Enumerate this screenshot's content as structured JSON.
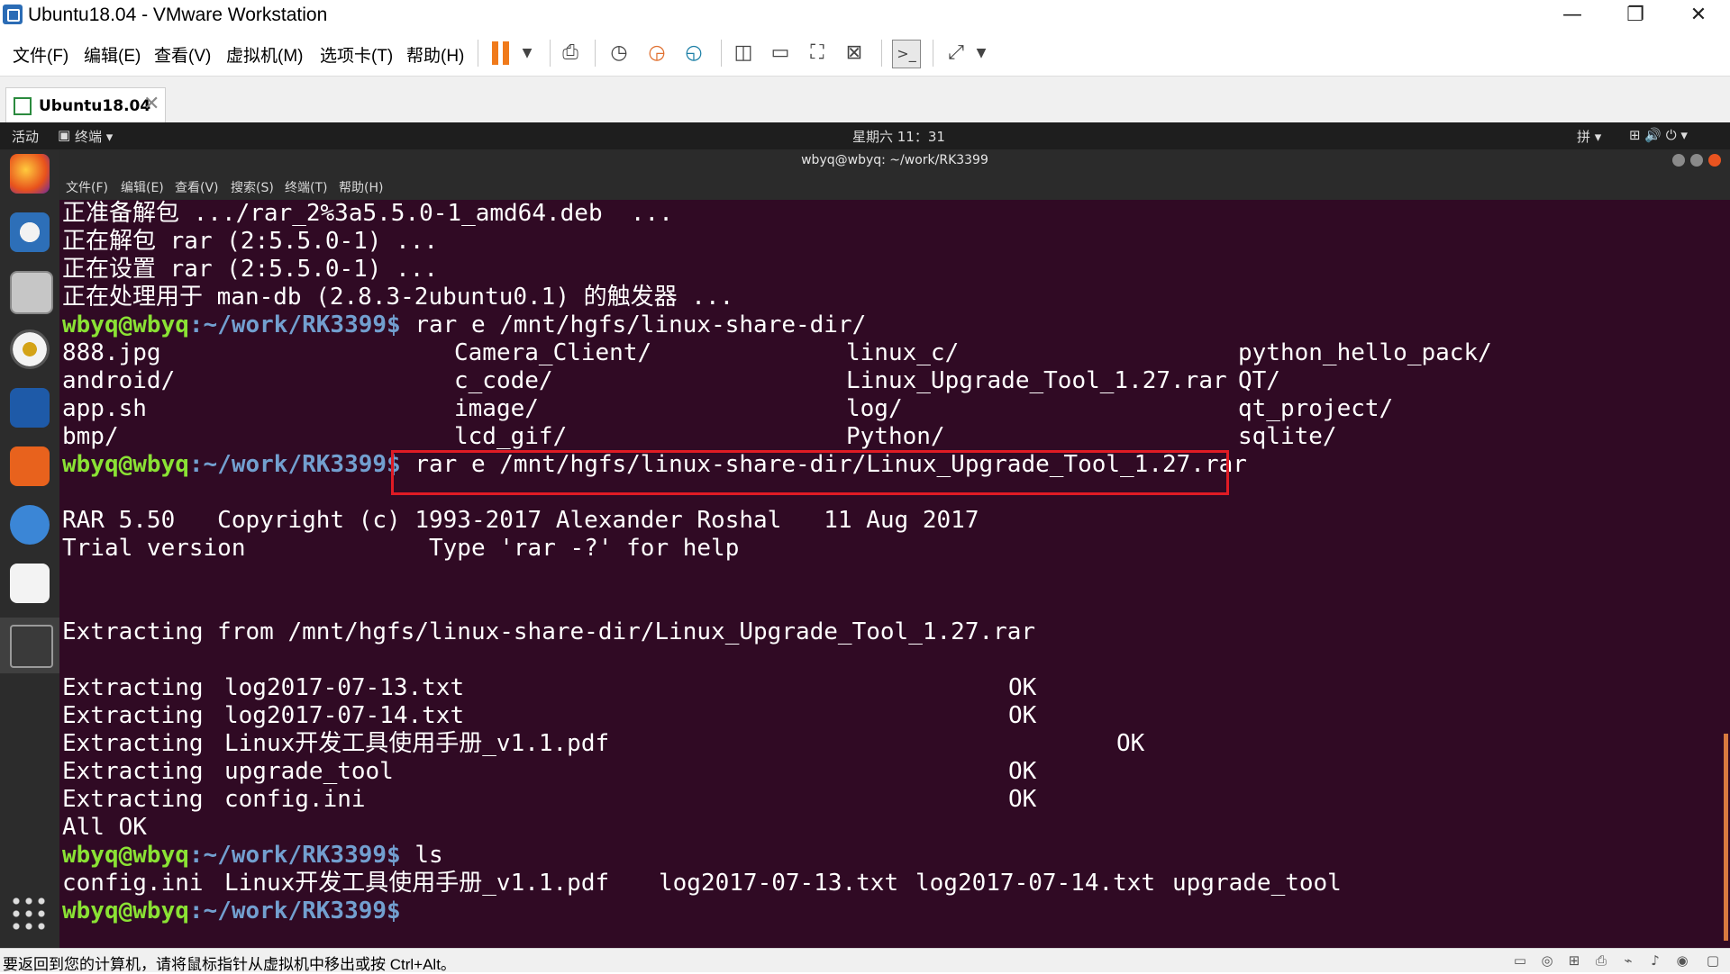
{
  "window": {
    "title": "Ubuntu18.04 - VMware Workstation",
    "minimize": "—",
    "restore": "❐",
    "close": "✕"
  },
  "menu": [
    "文件(F)",
    "编辑(E)",
    "查看(V)",
    "虚拟机(M)",
    "选项卡(T)",
    "帮助(H)"
  ],
  "tab": {
    "label": "Ubuntu18.04",
    "close": "✕"
  },
  "gnome_panel": {
    "activities": "活动",
    "app_menu": "终端 ▾",
    "clock": "星期六 11：31",
    "input_method": "拼 ▾",
    "system_icons": "⊞  🔊  ⏻ ▾"
  },
  "terminal": {
    "title": "wbyq@wbyq: ~/work/RK3399",
    "menu": [
      "文件(F)",
      "编辑(E)",
      "查看(V)",
      "搜索(S)",
      "终端(T)",
      "帮助(H)"
    ],
    "prompt_user": "wbyq@wbyq",
    "prompt_path": ":~/work/RK3399$",
    "lines": {
      "l1": "正准备解包 .../rar_2%3a5.5.0-1_amd64.deb  ...",
      "l2": "正在解包 rar (2:5.5.0-1) ...",
      "l3": "正在设置 rar (2:5.5.0-1) ...",
      "l4": "正在处理用于 man-db (2.8.3-2ubuntu0.1) 的触发器 ...",
      "cmd1": " rar e /mnt/hgfs/linux-share-dir/",
      "cmd2": " rar e /mnt/hgfs/linux-share-dir/Linux_Upgrade_Tool_1.27.rar",
      "rar_banner": "RAR 5.50   Copyright (c) 1993-2017 Alexander Roshal   11 Aug 2017",
      "trial": "Trial version             Type 'rar -?' for help",
      "extract_from": "Extracting from /mnt/hgfs/linux-share-dir/Linux_Upgrade_Tool_1.27.rar",
      "all_ok": "All OK",
      "cmd3": " ls"
    },
    "listing": [
      [
        "888.jpg",
        "Camera_Client/",
        "linux_c/",
        "python_hello_pack/"
      ],
      [
        "android/",
        "c_code/",
        "Linux_Upgrade_Tool_1.27.rar",
        "QT/"
      ],
      [
        "app.sh",
        "image/",
        "log/",
        "qt_project/"
      ],
      [
        "bmp/",
        "lcd_gif/",
        "Python/",
        "sqlite/"
      ]
    ],
    "extracted": [
      {
        "file": "log2017-07-13.txt",
        "status": "OK"
      },
      {
        "file": "log2017-07-14.txt",
        "status": "OK"
      },
      {
        "file": "Linux开发工具使用手册_v1.1.pdf",
        "status": "OK"
      },
      {
        "file": "upgrade_tool",
        "status": "OK"
      },
      {
        "file": "config.ini",
        "status": "OK"
      }
    ],
    "extracting_word": "Extracting",
    "ls_output": [
      "config.ini",
      "Linux开发工具使用手册_v1.1.pdf",
      "log2017-07-13.txt",
      "log2017-07-14.txt",
      "upgrade_tool"
    ]
  },
  "statusbar": {
    "text": "要返回到您的计算机，请将鼠标指针从虚拟机中移出或按 Ctrl+Alt。"
  },
  "colors": {
    "terminal_bg": "#300a24",
    "prompt_green": "#8ae234",
    "path_blue": "#729fcf",
    "highlight_red": "#e01b24",
    "pause_orange": "#f07a1b"
  }
}
